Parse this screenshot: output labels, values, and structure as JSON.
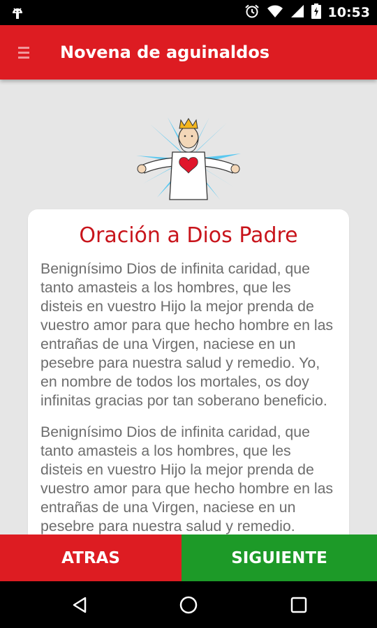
{
  "status_bar": {
    "time": "10:53",
    "icons": [
      "android-icon",
      "alarm-icon",
      "wifi-icon",
      "signal-icon",
      "battery-icon"
    ]
  },
  "app_bar": {
    "title": "Novena de aguinaldos",
    "menu_icon": "hamburger-menu-icon"
  },
  "hero": {
    "icon": "dios-padre-illustration"
  },
  "card": {
    "heading": "Oración a Dios Padre",
    "paragraphs": [
      "Benignísimo Dios de infinita caridad, que tanto amasteis a los hombres, que les disteis en vuestro Hijo la mejor prenda de vuestro amor para que hecho hombre en las entrañas de una Virgen, naciese en un pesebre para nuestra salud y remedio. Yo, en nombre de todos los mortales, os doy infinitas gracias por tan soberano beneficio.",
      "Benignísimo Dios de infinita caridad, que tanto amasteis a los hombres, que les disteis en vuestro Hijo la mejor prenda de vuestro amor para que hecho hombre en las entrañas de una Virgen, naciese en un pesebre para nuestra salud y remedio."
    ]
  },
  "buttons": {
    "back_label": "ATRAS",
    "next_label": "SIGUIENTE"
  },
  "colors": {
    "primary_red": "#dd1c22",
    "heading_red": "#c8141b",
    "next_green": "#1d9a28",
    "background": "#e6e6e6"
  },
  "nav_bar": {
    "icons": [
      "back-triangle-icon",
      "home-circle-icon",
      "recents-square-icon"
    ]
  }
}
